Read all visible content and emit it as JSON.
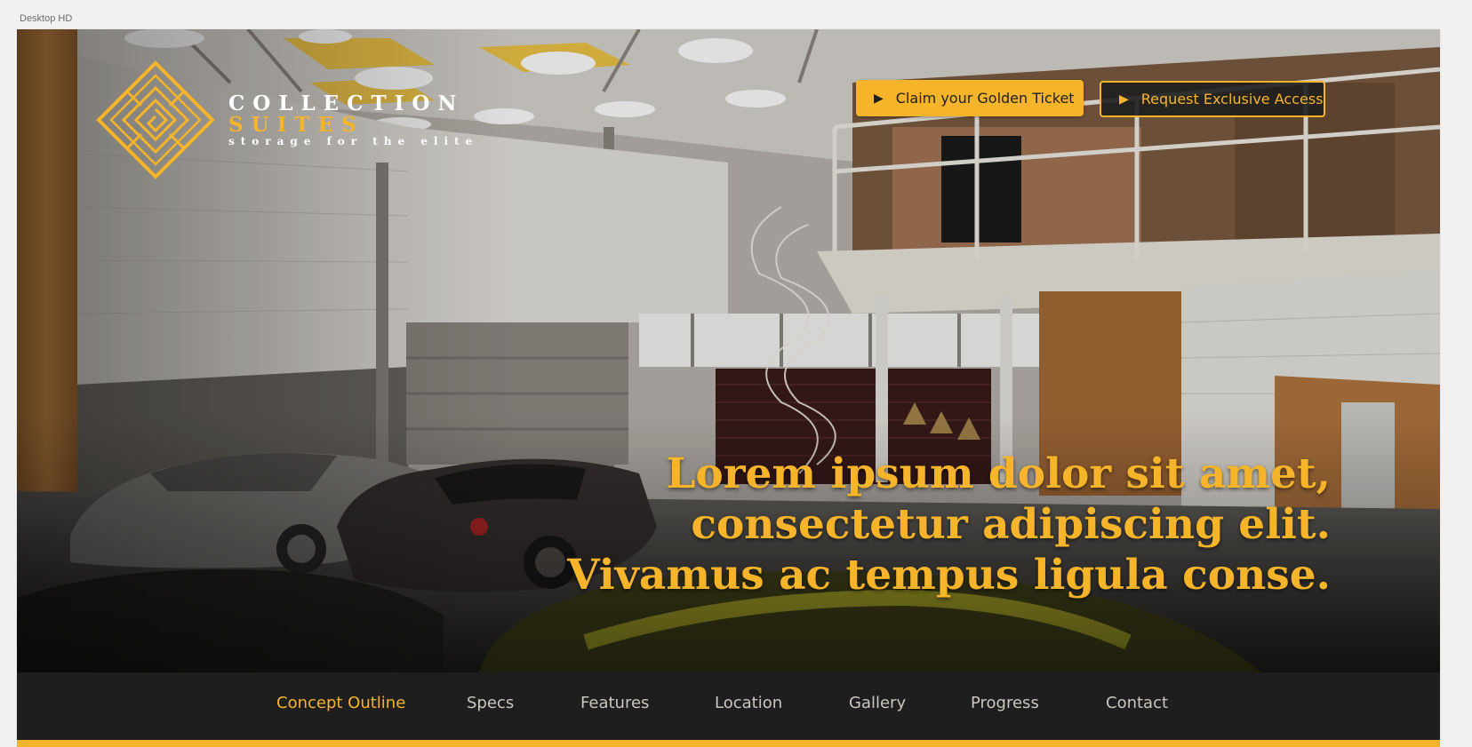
{
  "canvas": {
    "frame_label": "Desktop HD"
  },
  "brand": {
    "line1": "COLLECTION",
    "line2": "SUITES",
    "line3": "storage for the elite",
    "logo_icon": "diamond-maze-logo"
  },
  "header_buttons": {
    "primary_label": "Claim your Golden Ticket",
    "secondary_label": "Request Exclusive Access",
    "play_icon": "play-icon"
  },
  "hero": {
    "image": "garage-interior-with-luxury-cars",
    "headline_lines": [
      "Lorem ipsum dolor sit amet,",
      "consectetur adipiscing elit.",
      "Vivamus ac tempus ligula conse."
    ]
  },
  "nav": {
    "items": [
      "Concept Outline",
      "Specs",
      "Features",
      "Location",
      "Gallery",
      "Progress",
      "Contact"
    ],
    "active_index": 0
  },
  "colors": {
    "accent": "#f5b429",
    "dark": "#1e1e1e",
    "nav_text": "#c9c6bf",
    "canvas_bg": "#f1f1f1"
  }
}
